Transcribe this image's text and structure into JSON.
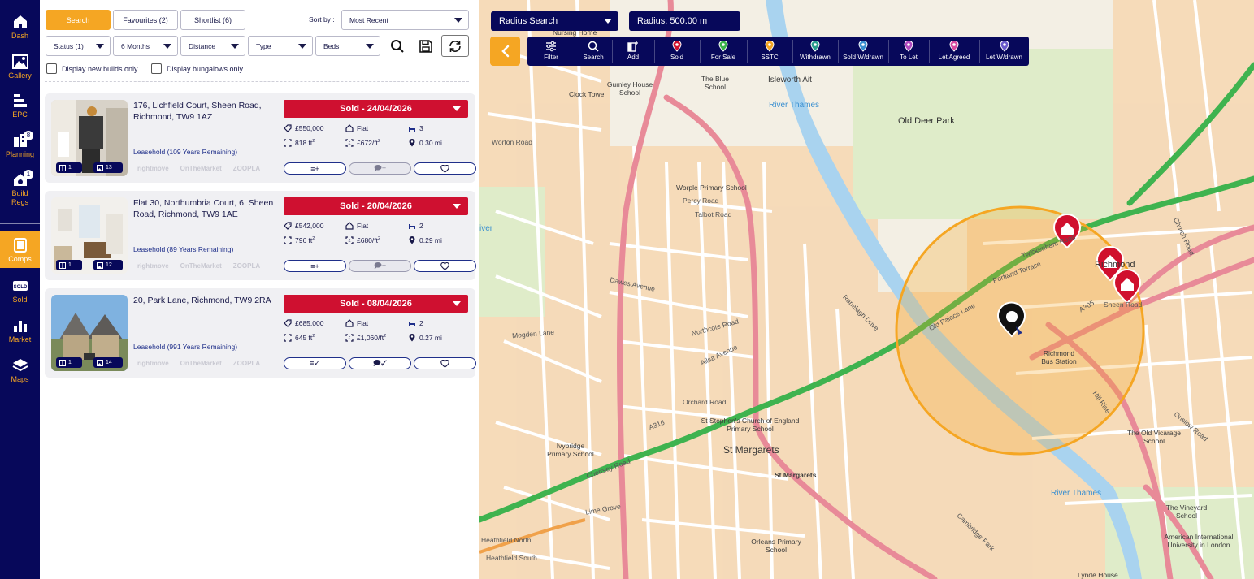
{
  "sidebar": {
    "items": [
      {
        "label": "Dash",
        "icon": "home-icon"
      },
      {
        "label": "Gallery",
        "icon": "gallery-icon"
      },
      {
        "label": "EPC",
        "icon": "epc-icon"
      },
      {
        "label": "Planning",
        "icon": "planning-icon",
        "badge": "8"
      },
      {
        "label": "Build Regs",
        "icon": "build-regs-icon",
        "badge": "1"
      },
      {
        "label": "Comps",
        "icon": "comps-icon",
        "active": true
      },
      {
        "label": "Sold",
        "icon": "sold-sign-icon"
      },
      {
        "label": "Market",
        "icon": "bar-chart-icon"
      },
      {
        "label": "Maps",
        "icon": "layers-icon"
      }
    ]
  },
  "tabs": {
    "search": "Search",
    "favourites": "Favourites (2)",
    "shortlist": "Shortlist (6)"
  },
  "sort": {
    "label": "Sort by :",
    "value": "Most Recent"
  },
  "filters": {
    "status": "Status (1)",
    "period": "6 Months",
    "distance": "Distance",
    "type": "Type",
    "beds": "Beds"
  },
  "checkboxes": {
    "new_builds": "Display new builds only",
    "bungalows": "Display bungalows only"
  },
  "listings": [
    {
      "address": "176, Lichfield Court, Sheen Road, Richmond, TW9 1AZ",
      "tenure": "Leasehold (109 Years Remaining)",
      "status": "Sold - 24/04/2026",
      "price": "£550,000",
      "type": "Flat",
      "beds": "3",
      "area": "818 ft",
      "ppsf": "£672/ft",
      "distance": "0.30 mi",
      "floorplans": "1",
      "photos": "13",
      "notes_label": "≡+",
      "comments_label": "🗩+"
    },
    {
      "address": "Flat 30, Northumbria Court, 6, Sheen Road, Richmond, TW9 1AE",
      "tenure": "Leasehold (89 Years Remaining)",
      "status": "Sold - 20/04/2026",
      "price": "£542,000",
      "type": "Flat",
      "beds": "2",
      "area": "796 ft",
      "ppsf": "£680/ft",
      "distance": "0.29 mi",
      "floorplans": "1",
      "photos": "12",
      "notes_label": "≡+",
      "comments_label": "🗩+"
    },
    {
      "address": "20, Park Lane, Richmond, TW9 2RA",
      "tenure": "Leasehold (991 Years Remaining)",
      "status": "Sold - 08/04/2026",
      "price": "£685,000",
      "type": "Flat",
      "beds": "2",
      "area": "645 ft",
      "ppsf": "£1,060/ft",
      "distance": "0.27 mi",
      "floorplans": "1",
      "photos": "14",
      "notes_label": "≡✓",
      "comments_label": "🗩✓"
    }
  ],
  "portals": [
    "rightmove",
    "OnTheMarket",
    "ZOOPLA"
  ],
  "sup": "2",
  "map": {
    "search_mode": "Radius Search",
    "radius": "Radius: 500.00 m",
    "tools": [
      {
        "label": "Filter",
        "icon": "sliders-icon"
      },
      {
        "label": "Search",
        "icon": "search-icon"
      },
      {
        "label": "Add",
        "icon": "add-icon"
      },
      {
        "label": "Sold",
        "icon": "pin-sold-icon",
        "color": "#d0102e"
      },
      {
        "label": "For Sale",
        "icon": "pin-for-sale-icon",
        "color": "#3cb44b"
      },
      {
        "label": "SSTC",
        "icon": "pin-sstc-icon",
        "color": "#f5a623"
      },
      {
        "label": "Withdrawn",
        "icon": "pin-withdrawn-icon",
        "color": "#2a9d8f"
      },
      {
        "label": "Sold W/drawn",
        "icon": "pin-sold-withdrawn-icon",
        "color": "#3a8fd0"
      },
      {
        "label": "To Let",
        "icon": "pin-to-let-icon",
        "color": "#b04ac0"
      },
      {
        "label": "Let Agreed",
        "icon": "pin-let-agreed-icon",
        "color": "#d94aa0"
      },
      {
        "label": "Let W/drawn",
        "icon": "pin-let-withdrawn-icon",
        "color": "#6a5acd"
      }
    ],
    "labels": {
      "nursing_home": "Nursing Home",
      "isleworth_ait": "Isleworth Ait",
      "the_blue_school": "The Blue School",
      "gumley_house_school": "Gumley House School",
      "clock_tower": "Clock Towe",
      "river_thames_1": "River Thames",
      "old_deer_park": "Old Deer Park",
      "worton_road": "Worton Road",
      "worple_primary": "Worple Primary School",
      "percy_road": "Percy Road",
      "talbot_road": "Talbot Road",
      "dawes_avenue": "Dawes Avenue",
      "mogden_lane": "Mogden Lane",
      "northcote_road": "Northcote Road",
      "ailsa_avenue": "Ailsa Avenue",
      "orchard_road": "Orchard Road",
      "st_stephens": "St Stephen's Church of England Primary School",
      "st_margarets": "St Margarets",
      "st_margarets_station": "St Margarets",
      "ivybridge": "Ivybridge Primary School",
      "twickenham_road": "Twickenham Road",
      "old_palace_lane": "Old Palace Lane",
      "portland_terrace": "Portland Terrace",
      "richmond_bus": "Richmond Bus Station",
      "richmond": "Richmond",
      "sheen_road": "Sheen Road",
      "church_road": "Church Road",
      "river_thames_2": "River Thames",
      "the_old_vicarage": "The Old Vicarage School",
      "the_vineyard": "The Vineyard School",
      "american_uni": "American International University in London",
      "heathfield_north": "Heathfield North",
      "heathfield_south": "Heathfield South",
      "orleans_primary": "Orleans Primary School",
      "lime_grove": "Lime Grove",
      "ranelagh_drive": "Ranelagh Drive",
      "chertsey_road": "Chertsey Road",
      "a316": "A316",
      "a305": "A305",
      "hill_rise": "Hill Rise",
      "cambridge_park": "Cambridge Park",
      "onslow_road": "Onslow Road",
      "river_left": "iver",
      "lynde_house": "Lynde House"
    }
  }
}
